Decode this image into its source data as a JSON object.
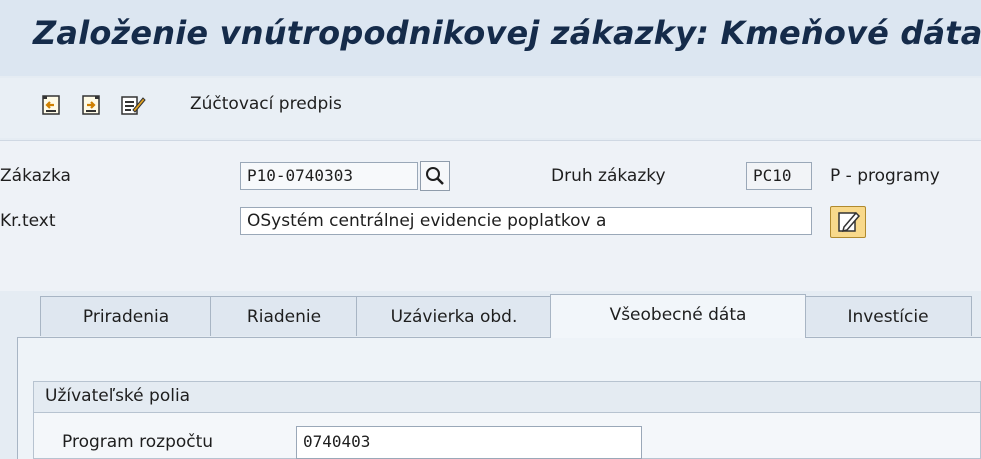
{
  "window": {
    "title": "Založenie vnútropodnikovej zákazky: Kmeňové dáta"
  },
  "toolbar": {
    "icons": [
      "previous-record-icon",
      "next-record-icon",
      "edit-settlement-icon"
    ],
    "settlement_label": "Zúčtovací predpis"
  },
  "header": {
    "order_label": "Zákazka",
    "order_value": "P10-0740303",
    "order_type_label": "Druh zákazky",
    "order_type_value": "PC10",
    "order_type_text": "P - programy",
    "short_text_label": "Kr.text",
    "short_text_value": "OSystém centrálnej evidencie poplatkov a"
  },
  "tabs": [
    {
      "label": "Priradenia"
    },
    {
      "label": "Riadenie"
    },
    {
      "label": "Uzávierka obd."
    },
    {
      "label": "Všeobecné dáta"
    },
    {
      "label": "Investície"
    }
  ],
  "active_tab": "Všeobecné dáta",
  "user_fields": {
    "group_title": "Užívateľské polia",
    "program_label": "Program rozpočtu",
    "program_value": "0740403"
  }
}
